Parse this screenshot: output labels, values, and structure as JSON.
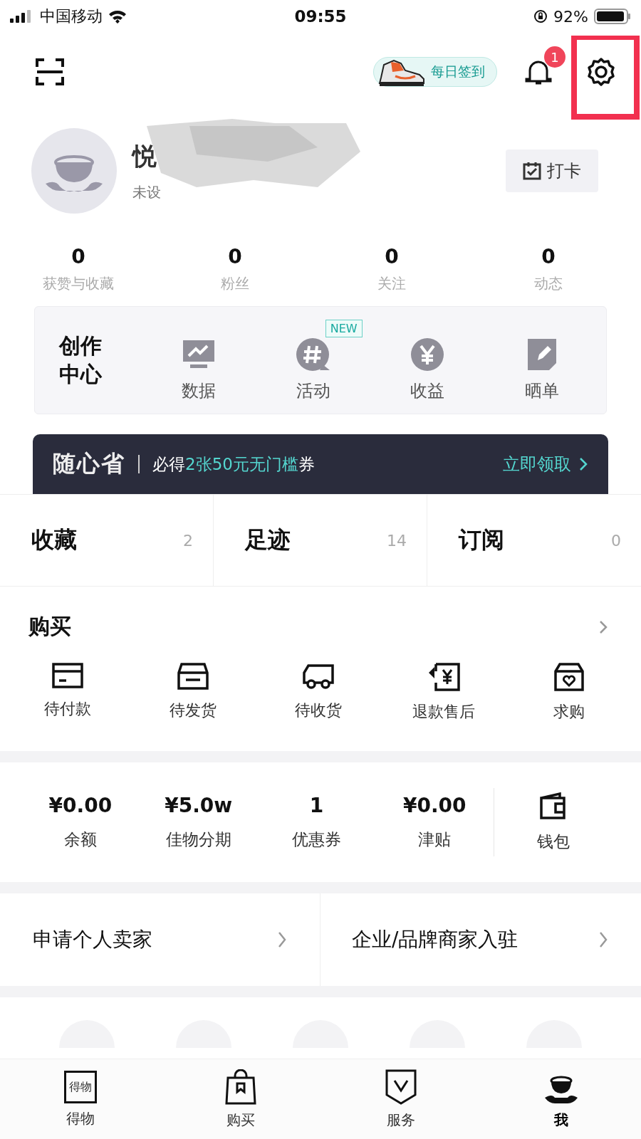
{
  "status_bar": {
    "carrier": "中国移动",
    "time": "09:55",
    "battery": "92%"
  },
  "header": {
    "checkin_pill": "每日签到",
    "notification_badge": "1",
    "settings_highlighted": true
  },
  "profile": {
    "name_initial": "悦",
    "subtitle": "未设",
    "punch_button": "打卡"
  },
  "stats": [
    {
      "value": "0",
      "label": "获赞与收藏"
    },
    {
      "value": "0",
      "label": "粉丝"
    },
    {
      "value": "0",
      "label": "关注"
    },
    {
      "value": "0",
      "label": "动态"
    }
  ],
  "creation_center": {
    "title": "创作中心",
    "items": [
      {
        "kind": "chart",
        "label": "数据"
      },
      {
        "kind": "hash",
        "label": "活动",
        "badge": "NEW"
      },
      {
        "kind": "yen",
        "label": "收益"
      },
      {
        "kind": "edit",
        "label": "晒单"
      }
    ]
  },
  "banner": {
    "brand": "随心省",
    "text_before": "必得",
    "highlight": "2张50元无门槛",
    "text_after": "券",
    "action": "立即领取"
  },
  "counters": [
    {
      "label": "收藏",
      "count": "2"
    },
    {
      "label": "足迹",
      "count": "14"
    },
    {
      "label": "订阅",
      "count": "0"
    }
  ],
  "purchase": {
    "title": "购买",
    "items": [
      {
        "kind": "card",
        "label": "待付款"
      },
      {
        "kind": "box",
        "label": "待发货"
      },
      {
        "kind": "truck",
        "label": "待收货"
      },
      {
        "kind": "refund",
        "label": "退款售后"
      },
      {
        "kind": "bag",
        "label": "求购"
      }
    ]
  },
  "wallet": {
    "items": [
      {
        "value": "¥0.00",
        "label": "余额"
      },
      {
        "value": "¥5.0w",
        "label": "佳物分期"
      },
      {
        "value": "1",
        "label": "优惠券"
      },
      {
        "value": "¥0.00",
        "label": "津贴"
      }
    ],
    "wallet_label": "钱包"
  },
  "seller_links": [
    "申请个人卖家",
    "企业/品牌商家入驻"
  ],
  "tab_bar": [
    {
      "kind": "logo",
      "logo_text": "得物",
      "label": "得物",
      "selected": false
    },
    {
      "kind": "bag",
      "label": "购买",
      "selected": false
    },
    {
      "kind": "shield",
      "label": "服务",
      "selected": false
    },
    {
      "kind": "avatar",
      "label": "我",
      "selected": true
    }
  ]
}
